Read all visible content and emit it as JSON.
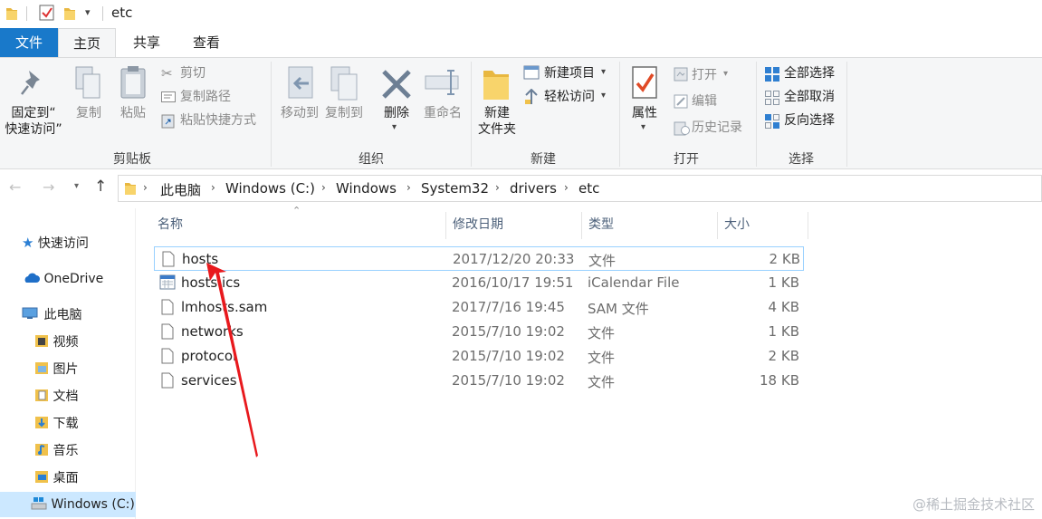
{
  "window": {
    "title": "etc"
  },
  "tabs": [
    "文件",
    "主页",
    "共享",
    "查看"
  ],
  "ribbon": {
    "clipboard": {
      "label": "剪贴板",
      "pin": "固定到“\n快速访问”",
      "copy": "复制",
      "paste": "粘贴",
      "cut": "剪切",
      "copy_path": "复制路径",
      "paste_shortcut": "粘贴快捷方式"
    },
    "organize": {
      "label": "组织",
      "move_to": "移动到",
      "copy_to": "复制到",
      "delete": "删除",
      "rename": "重命名"
    },
    "new": {
      "label": "新建",
      "new_folder": "新建\n文件夹",
      "new_item": "新建项目",
      "easy_access": "轻松访问"
    },
    "open": {
      "label": "打开",
      "properties": "属性",
      "open": "打开",
      "edit": "编辑",
      "history": "历史记录"
    },
    "select": {
      "label": "选择",
      "select_all": "全部选择",
      "select_none": "全部取消",
      "invert": "反向选择"
    }
  },
  "breadcrumb": [
    "此电脑",
    "Windows (C:)",
    "Windows",
    "System32",
    "drivers",
    "etc"
  ],
  "nav": {
    "quick_access": "快速访问",
    "onedrive": "OneDrive",
    "this_pc": "此电脑",
    "children": [
      "视频",
      "图片",
      "文档",
      "下载",
      "音乐",
      "桌面",
      "Windows (C:)"
    ]
  },
  "columns": {
    "name": "名称",
    "date": "修改日期",
    "type": "类型",
    "size": "大小"
  },
  "files": [
    {
      "name": "hosts",
      "date": "2017/12/20 20:33",
      "type": "文件",
      "size": "2 KB"
    },
    {
      "name": "hosts.ics",
      "date": "2016/10/17 19:51",
      "type": "iCalendar File",
      "size": "1 KB"
    },
    {
      "name": "lmhosts.sam",
      "date": "2017/7/16 19:45",
      "type": "SAM 文件",
      "size": "4 KB"
    },
    {
      "name": "networks",
      "date": "2015/7/10 19:02",
      "type": "文件",
      "size": "1 KB"
    },
    {
      "name": "protocol",
      "date": "2015/7/10 19:02",
      "type": "文件",
      "size": "2 KB"
    },
    {
      "name": "services",
      "date": "2015/7/10 19:02",
      "type": "文件",
      "size": "18 KB"
    }
  ],
  "watermark": "@稀土掘金技术社区",
  "colors": {
    "accent": "#1979ca",
    "selection": "#cce8ff",
    "annotation": "#e8191d"
  }
}
